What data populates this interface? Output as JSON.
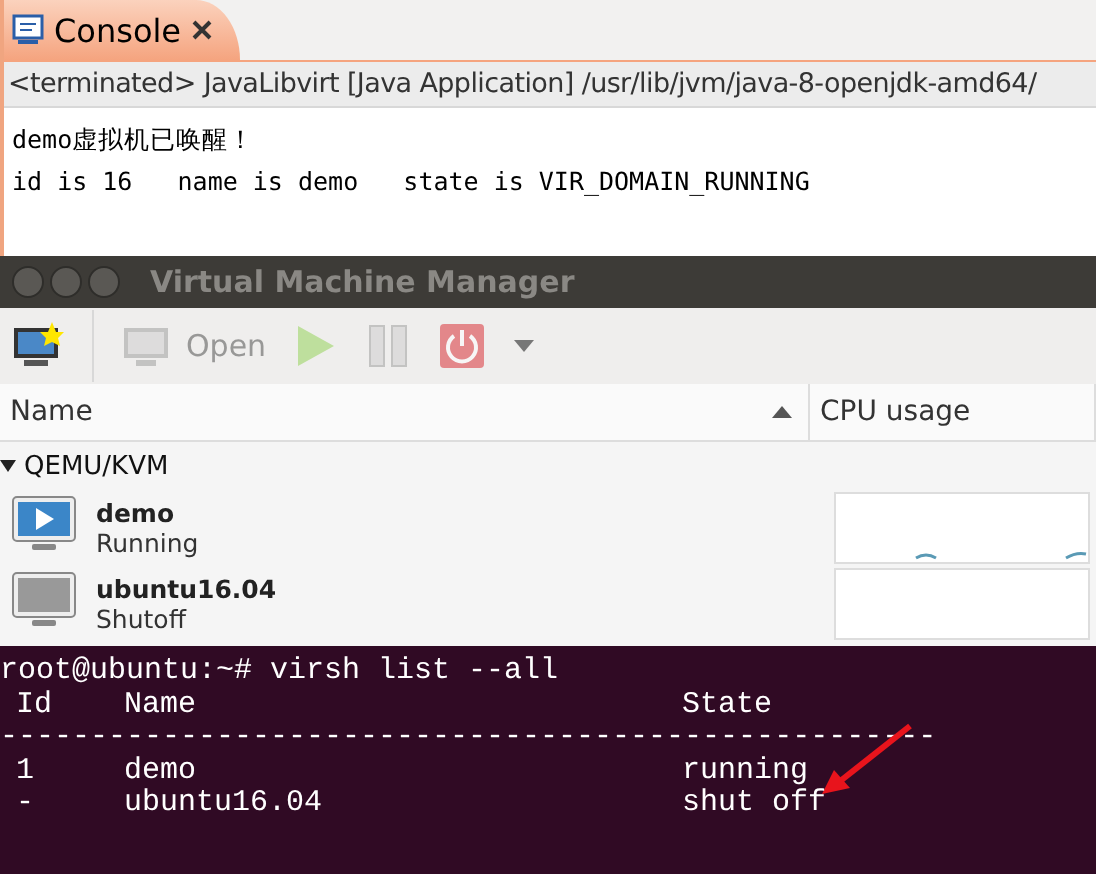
{
  "console": {
    "tab_title": "Console",
    "info_line": "<terminated> JavaLibvirt [Java Application] /usr/lib/jvm/java-8-openjdk-amd64/",
    "output_lines": [
      "demo虚拟机已唤醒！",
      "id is 16   name is demo   state is VIR_DOMAIN_RUNNING"
    ]
  },
  "vmm": {
    "window_title": "Virtual Machine Manager",
    "toolbar": [
      {
        "kind": "new",
        "disabled": false
      },
      {
        "kind": "open",
        "label": "Open",
        "disabled": true
      },
      {
        "kind": "run",
        "disabled": true
      },
      {
        "kind": "pause",
        "disabled": true
      },
      {
        "kind": "shutdown",
        "disabled": true
      },
      {
        "kind": "menu",
        "disabled": false
      }
    ],
    "columns": [
      {
        "label": "Name",
        "sorted": true
      },
      {
        "label": "CPU usage",
        "sorted": false
      }
    ],
    "group": {
      "name": "QEMU/KVM",
      "expanded": true,
      "vms": [
        {
          "name": "demo",
          "status": "Running",
          "kind": "running"
        },
        {
          "name": "ubuntu16.04",
          "status": "Shutoff",
          "kind": "shutoff"
        }
      ]
    }
  },
  "terminal": {
    "command": "root@ubuntu:~# virsh list --all",
    "headers": [
      "Id",
      "Name",
      "State"
    ],
    "separator": "----------------------------------------------------",
    "rows": [
      {
        "cells": [
          "1",
          "demo",
          "running"
        ]
      },
      {
        "cells": [
          "-",
          "ubuntu16.04",
          "shut off"
        ]
      }
    ]
  }
}
